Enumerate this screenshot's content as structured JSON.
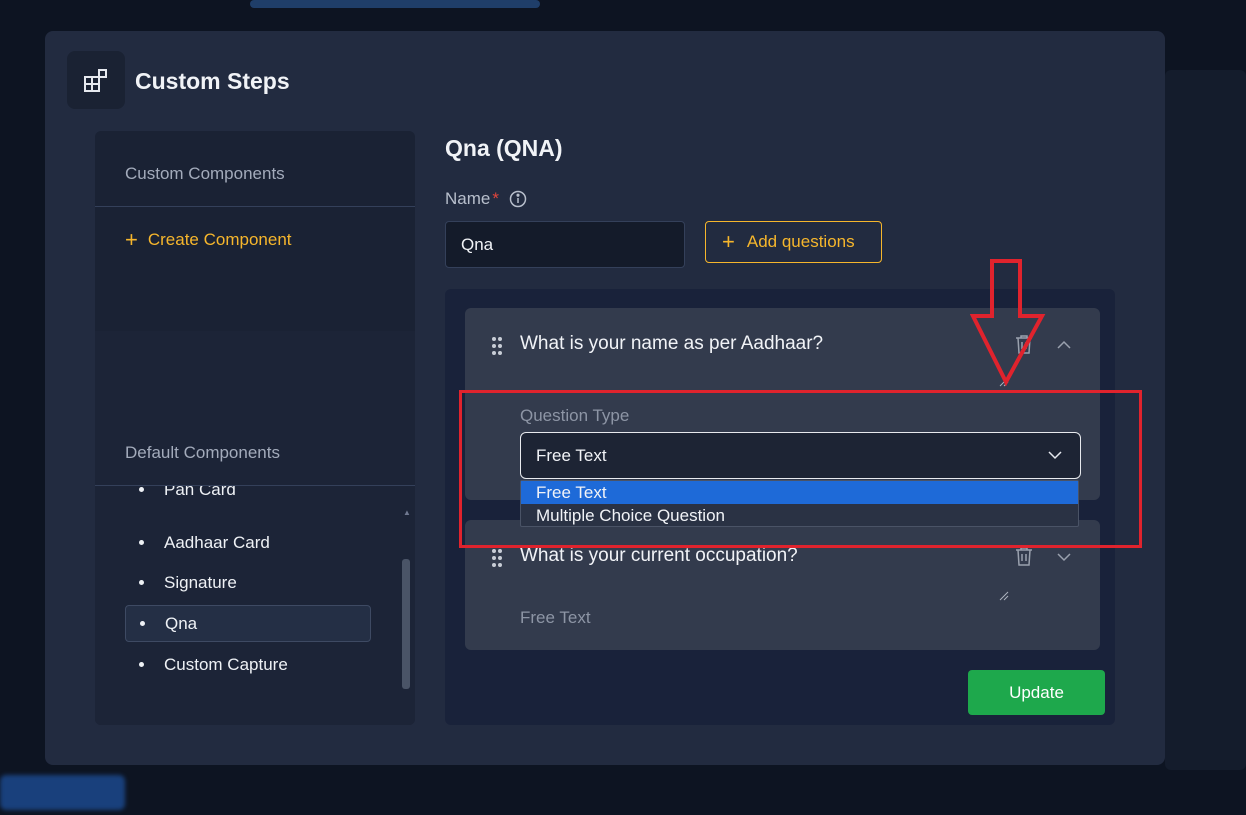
{
  "modal": {
    "title": "Custom Steps"
  },
  "left_panel": {
    "custom_title": "Custom Components",
    "create_label": "Create Component",
    "default_title": "Default Components",
    "items": [
      {
        "label": "Pan Card",
        "active": false
      },
      {
        "label": "Aadhaar Card",
        "active": false
      },
      {
        "label": "Signature",
        "active": false
      },
      {
        "label": "Qna",
        "active": true
      },
      {
        "label": "Custom Capture",
        "active": false
      }
    ]
  },
  "editor": {
    "heading": "Qna (QNA)",
    "name_label": "Name",
    "name_required_mark": "*",
    "name_value": "Qna",
    "add_questions_label": "Add questions",
    "update_label": "Update"
  },
  "questions": [
    {
      "text": "What is your name as per Aadhaar?",
      "type_label": "Question Type",
      "type_value": "Free Text",
      "expanded": true
    },
    {
      "text": "What is your current occupation?",
      "type_value": "Free Text",
      "expanded": false
    }
  ],
  "dropdown": {
    "options": [
      "Free Text",
      "Multiple Choice Question"
    ],
    "selected": "Free Text"
  },
  "colors": {
    "accent": "#f6b62c",
    "update_button": "#1ea84c",
    "selected_option": "#1e6ad8",
    "annotation": "#e0232d",
    "required": "#e2453c"
  }
}
